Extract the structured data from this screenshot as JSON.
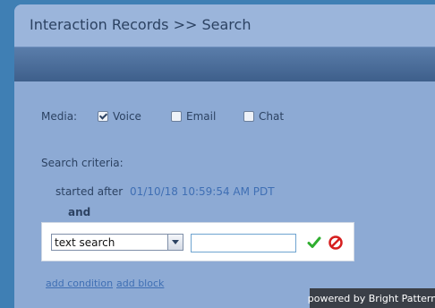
{
  "header": {
    "title": "Interaction Records >> Search"
  },
  "media": {
    "label": "Media:",
    "options": [
      {
        "label": "Voice",
        "checked": true
      },
      {
        "label": "Email",
        "checked": false
      },
      {
        "label": "Chat",
        "checked": false
      }
    ]
  },
  "search": {
    "label": "Search criteria:",
    "started_after_label": "started after",
    "started_after_value": "01/10/18 10:59:54 AM PDT",
    "and_label": "and",
    "criteria_select": "text search",
    "criteria_input": ""
  },
  "links": {
    "add_condition": "add condition",
    "add_block": "add block"
  },
  "footer": {
    "powered_by": "powered by Bright Pattern"
  },
  "colors": {
    "accept": "#2fae2f",
    "cancel": "#d61f1f",
    "link": "#3f6fb4"
  }
}
